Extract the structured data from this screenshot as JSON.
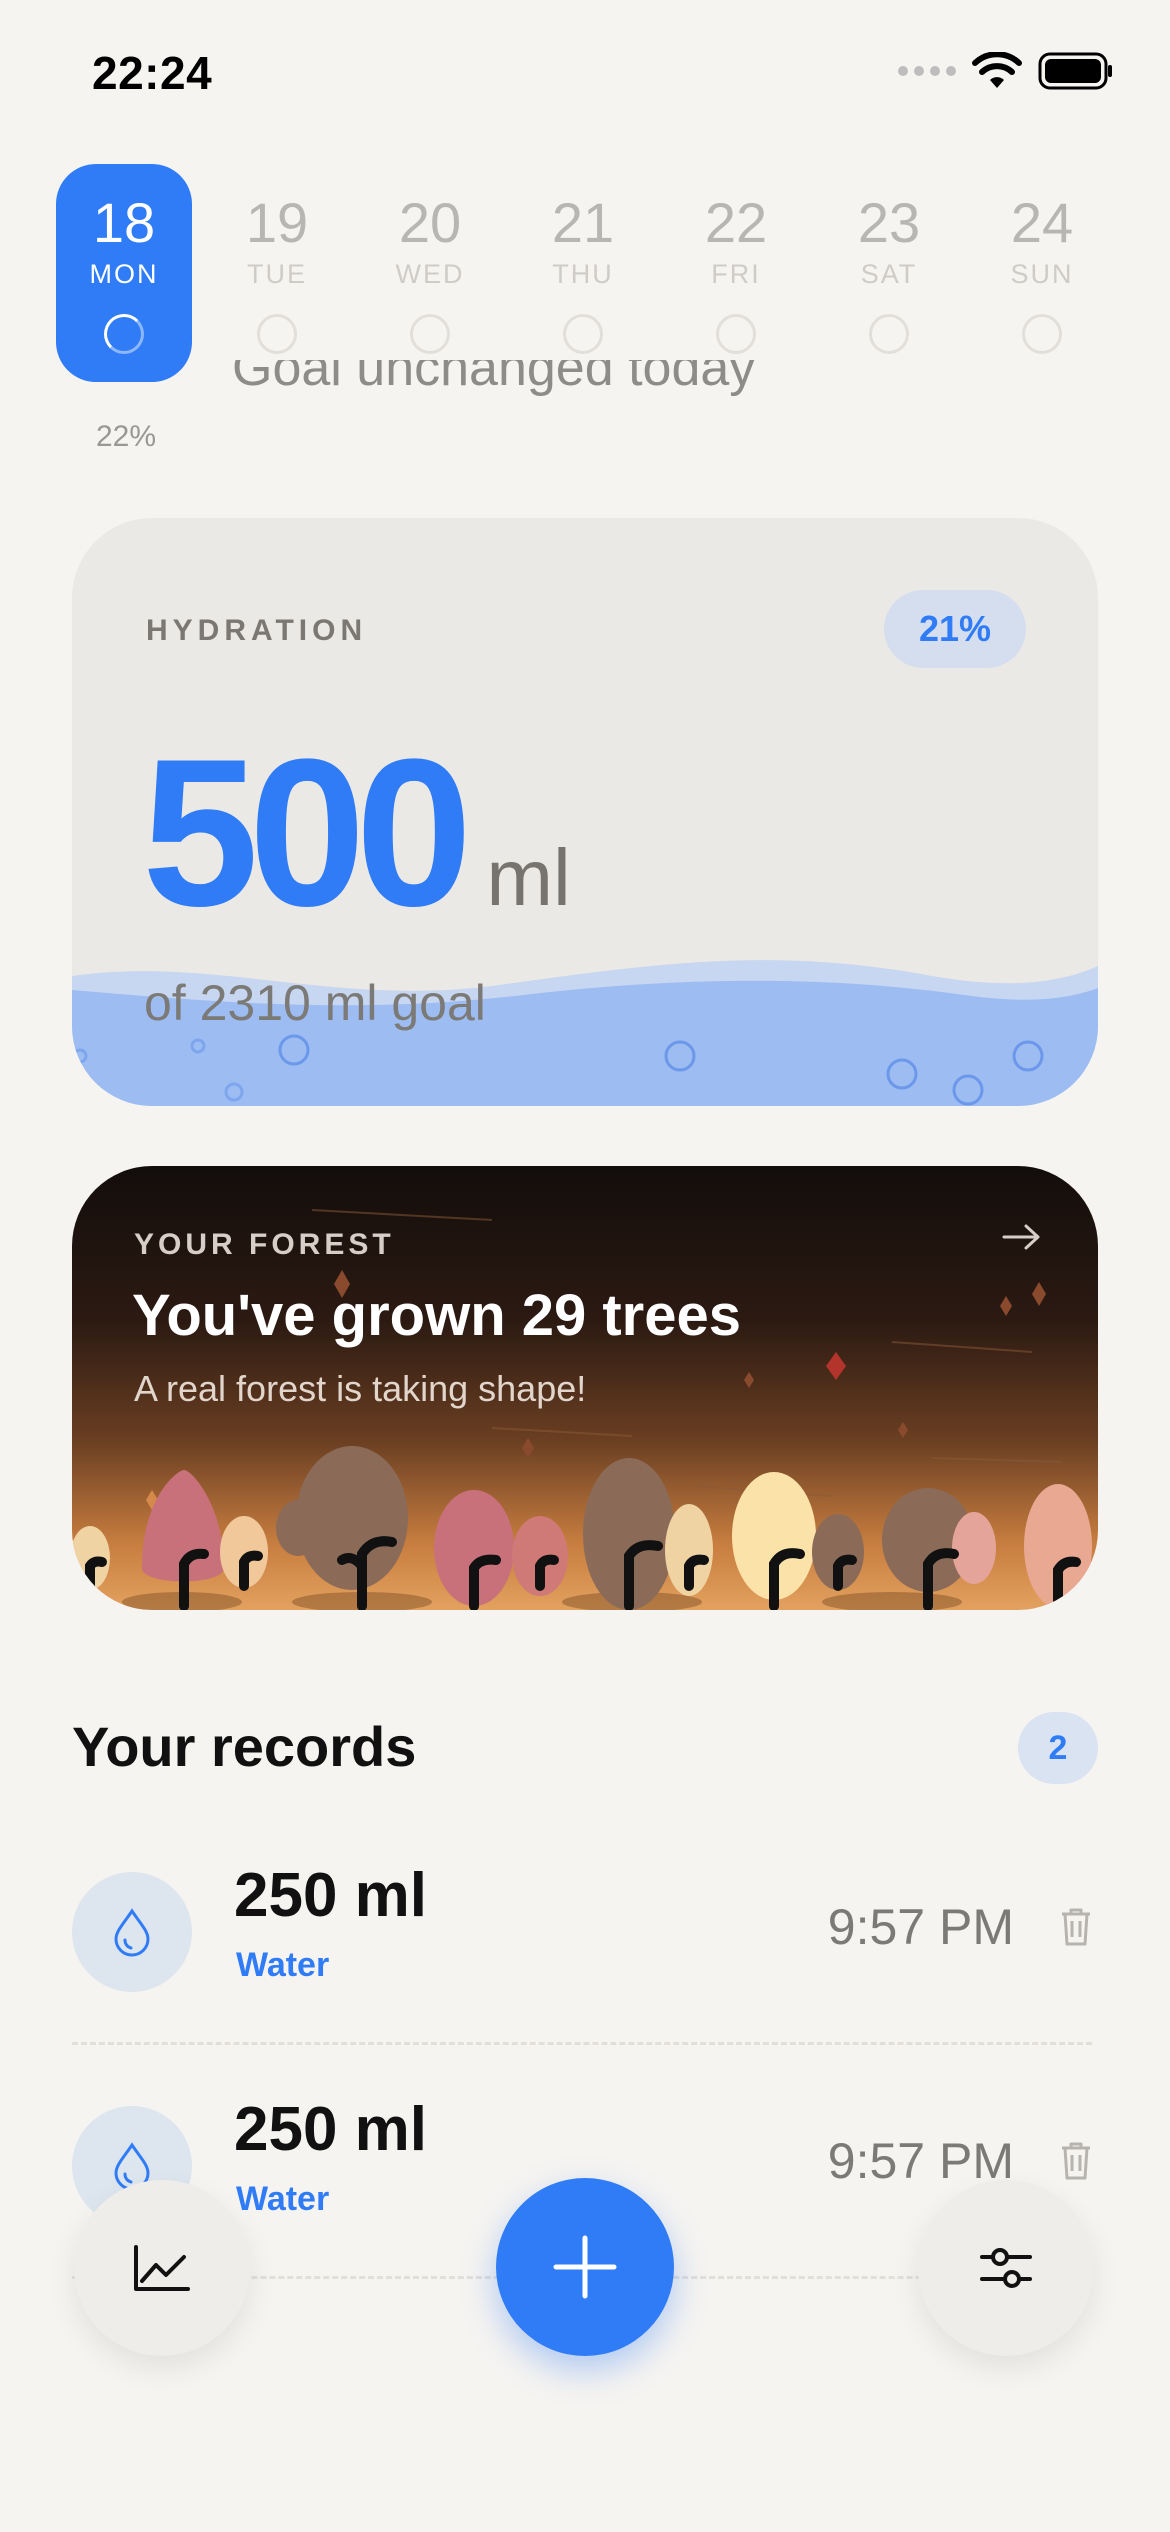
{
  "status_bar": {
    "time": "22:24"
  },
  "week": [
    {
      "num": "18",
      "name": "MON",
      "active": true
    },
    {
      "num": "19",
      "name": "TUE"
    },
    {
      "num": "20",
      "name": "WED"
    },
    {
      "num": "21",
      "name": "THU"
    },
    {
      "num": "22",
      "name": "FRI"
    },
    {
      "num": "23",
      "name": "SAT"
    },
    {
      "num": "24",
      "name": "SUN"
    }
  ],
  "goal_peek": "Goal unchanged today",
  "today_percent": "22%",
  "hydration": {
    "label": "HYDRATION",
    "badge": "21%",
    "value": "500",
    "unit": "ml",
    "goal_text": "of 2310 ml goal",
    "fill_fraction": 0.21
  },
  "forest": {
    "label": "YOUR FOREST",
    "title": "You've grown 29 trees",
    "subtitle": "A real forest is taking shape!"
  },
  "records": {
    "title": "Your records",
    "count": "2",
    "items": [
      {
        "amount": "250 ml",
        "kind": "Water",
        "time": "9:57 PM"
      },
      {
        "amount": "250 ml",
        "kind": "Water",
        "time": "9:57 PM"
      }
    ]
  },
  "colors": {
    "accent": "#2f7cf6",
    "background": "#f6f4f1"
  },
  "icons": {
    "stats": "chart-line-icon",
    "add": "plus-icon",
    "settings": "sliders-icon",
    "record": "water-drop-icon",
    "delete": "trash-icon",
    "forest_link": "arrow-right-icon"
  }
}
